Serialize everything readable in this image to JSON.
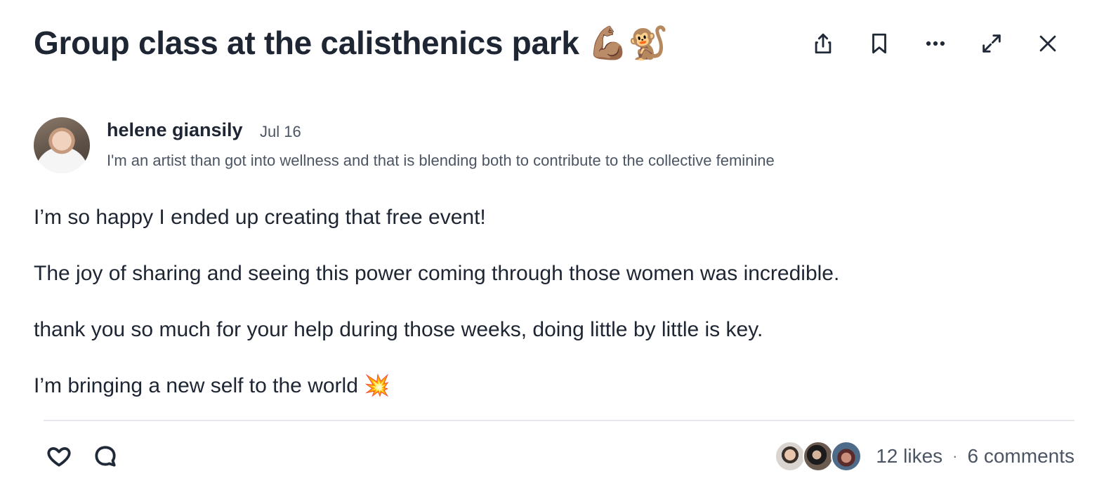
{
  "post": {
    "title": "Group class at the calisthenics park 💪🏽🐒",
    "author": {
      "name": "helene giansily",
      "date": "Jul 16",
      "bio": "I'm an artist than got into wellness and that is blending both to contribute to the collective feminine"
    },
    "paragraphs": [
      "I’m so happy I ended up creating that free event!",
      "The joy of sharing and seeing this power coming through those women was incredible.",
      "thank you so much for your help during those weeks, doing little by little is key.",
      "I’m bringing a new self to the world 💥"
    ],
    "likes_label": "12 likes",
    "separator": "·",
    "comments_label": "6 comments"
  },
  "toolbar": {
    "icons": [
      "share-icon",
      "bookmark-icon",
      "more-icon",
      "expand-icon",
      "close-icon"
    ]
  },
  "reactions": {
    "icons": [
      "heart-icon",
      "comment-icon"
    ]
  },
  "colors": {
    "text_primary": "#1e2533",
    "text_secondary": "#4b5563",
    "divider": "#e5e7eb"
  }
}
